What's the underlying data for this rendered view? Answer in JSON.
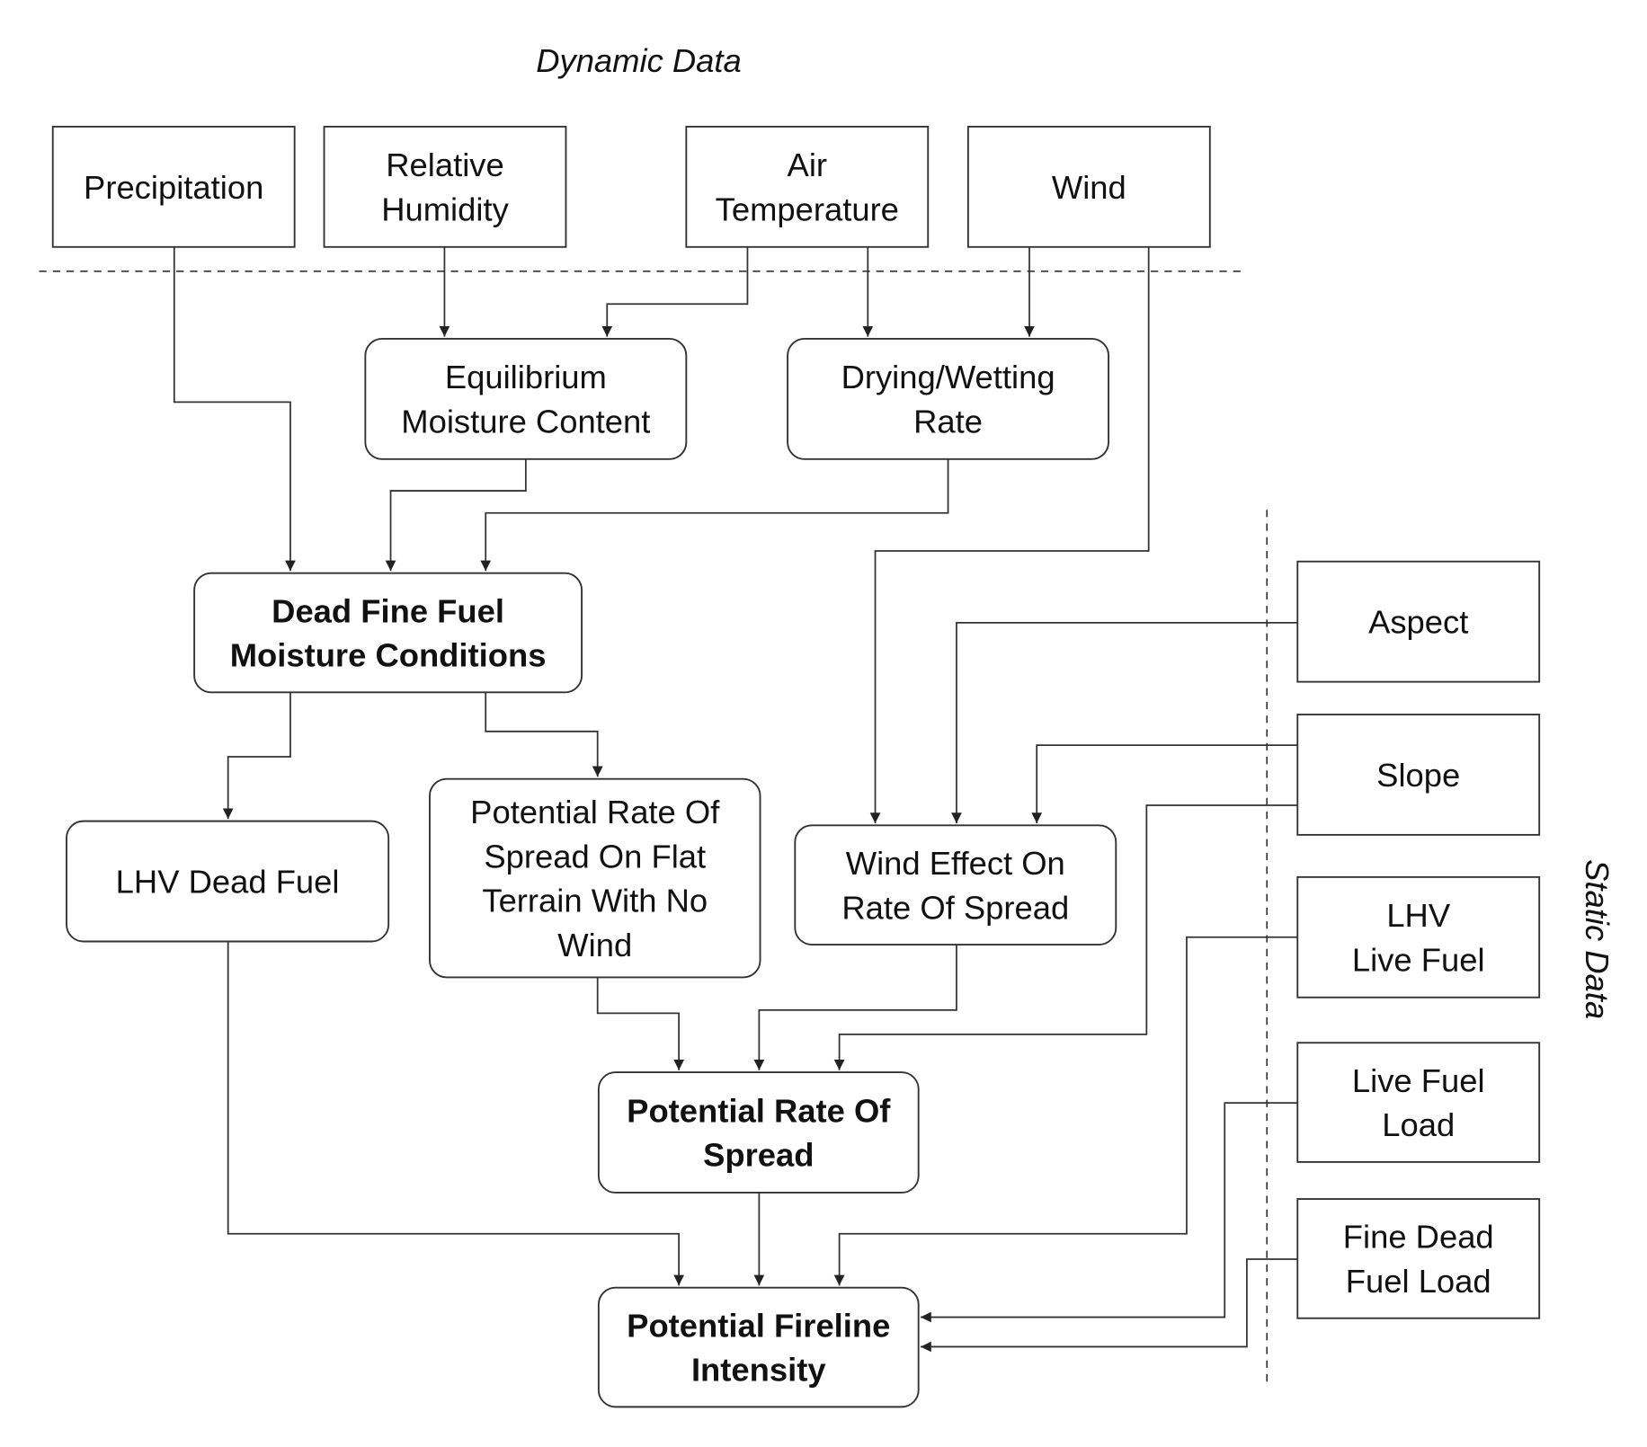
{
  "regions": {
    "dynamic": "Dynamic Data",
    "static": "Static Data"
  },
  "nodes": {
    "precipitation": [
      "Precipitation"
    ],
    "relative_humidity": [
      "Relative",
      "Humidity"
    ],
    "air_temperature": [
      "Air",
      "Temperature"
    ],
    "wind": [
      "Wind"
    ],
    "emc": [
      "Equilibrium",
      "Moisture Content"
    ],
    "drying_wetting": [
      "Drying/Wetting",
      "Rate"
    ],
    "dffmc": [
      "Dead Fine Fuel",
      "Moisture Conditions"
    ],
    "lhv_dead": [
      "LHV Dead Fuel"
    ],
    "pros_flat": [
      "Potential Rate Of",
      "Spread On Flat",
      "Terrain With No",
      "Wind"
    ],
    "wind_effect": [
      "Wind Effect On",
      "Rate Of Spread"
    ],
    "aspect": [
      "Aspect"
    ],
    "slope": [
      "Slope"
    ],
    "lhv_live": [
      "LHV",
      "Live Fuel"
    ],
    "live_fuel_load": [
      "Live Fuel",
      "Load"
    ],
    "fine_dead_fuel_load": [
      "Fine Dead",
      "Fuel Load"
    ],
    "pros": [
      "Potential Rate Of",
      "Spread"
    ],
    "pfi": [
      "Potential Fireline",
      "Intensity"
    ]
  },
  "edges": [
    [
      "precipitation",
      "dffmc"
    ],
    [
      "relative_humidity",
      "emc"
    ],
    [
      "air_temperature",
      "emc"
    ],
    [
      "air_temperature",
      "drying_wetting"
    ],
    [
      "wind",
      "drying_wetting"
    ],
    [
      "wind",
      "wind_effect"
    ],
    [
      "emc",
      "dffmc"
    ],
    [
      "drying_wetting",
      "dffmc"
    ],
    [
      "dffmc",
      "lhv_dead"
    ],
    [
      "dffmc",
      "pros_flat"
    ],
    [
      "aspect",
      "wind_effect"
    ],
    [
      "slope",
      "wind_effect"
    ],
    [
      "slope",
      "pros"
    ],
    [
      "pros_flat",
      "pros"
    ],
    [
      "wind_effect",
      "pros"
    ],
    [
      "lhv_dead",
      "pfi"
    ],
    [
      "pros",
      "pfi"
    ],
    [
      "lhv_live",
      "pfi"
    ],
    [
      "live_fuel_load",
      "pfi"
    ],
    [
      "fine_dead_fuel_load",
      "pfi"
    ]
  ]
}
